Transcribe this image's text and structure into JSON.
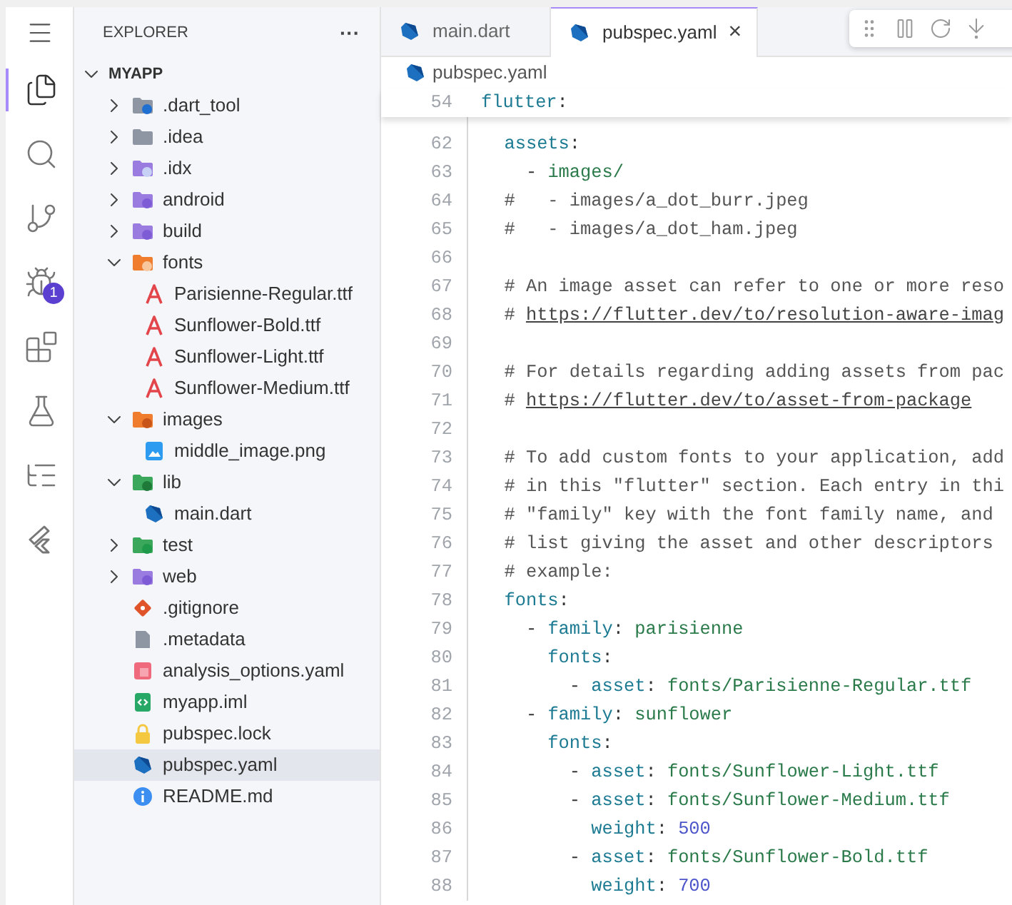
{
  "activity_bar": {
    "items": [
      {
        "kind": "files",
        "selected": true
      },
      {
        "kind": "search",
        "selected": false
      },
      {
        "kind": "git",
        "selected": false
      },
      {
        "kind": "debug",
        "selected": false,
        "badge": "1"
      },
      {
        "kind": "extensions",
        "selected": false
      },
      {
        "kind": "testing",
        "selected": false
      },
      {
        "kind": "outline",
        "selected": false
      },
      {
        "kind": "flutter",
        "selected": false
      }
    ]
  },
  "sidebar": {
    "title": "EXPLORER",
    "more": "···",
    "tree": {
      "label": "MYAPP",
      "expanded": true,
      "children": [
        {
          "label": ".dart_tool",
          "kind": "dartfolder",
          "expanded": false,
          "selected": false
        },
        {
          "label": ".idea",
          "kind": "folder",
          "expanded": false,
          "selected": false
        },
        {
          "label": ".idx",
          "kind": "idxfolder",
          "expanded": false,
          "selected": false
        },
        {
          "label": "android",
          "kind": "androidfolder",
          "expanded": false,
          "selected": false
        },
        {
          "label": "build",
          "kind": "buildfolder",
          "expanded": false,
          "selected": false
        },
        {
          "label": "fonts",
          "kind": "fontfolder",
          "expanded": true,
          "selected": false,
          "children": [
            {
              "label": "Parisienne-Regular.ttf",
              "kind": "font",
              "selected": false
            },
            {
              "label": "Sunflower-Bold.ttf",
              "kind": "font",
              "selected": false
            },
            {
              "label": "Sunflower-Light.ttf",
              "kind": "font",
              "selected": false
            },
            {
              "label": "Sunflower-Medium.ttf",
              "kind": "font",
              "selected": false
            }
          ]
        },
        {
          "label": "images",
          "kind": "imagefolder",
          "expanded": true,
          "selected": false,
          "children": [
            {
              "label": "middle_image.png",
              "kind": "image",
              "selected": false
            }
          ]
        },
        {
          "label": "lib",
          "kind": "libfolder",
          "expanded": true,
          "selected": false,
          "children": [
            {
              "label": "main.dart",
              "kind": "dart",
              "selected": false
            }
          ]
        },
        {
          "label": "test",
          "kind": "testfolder",
          "expanded": false,
          "selected": false
        },
        {
          "label": "web",
          "kind": "webfolder",
          "expanded": false,
          "selected": false
        },
        {
          "label": ".gitignore",
          "kind": "git",
          "selected": false
        },
        {
          "label": ".metadata",
          "kind": "file",
          "selected": false
        },
        {
          "label": "analysis_options.yaml",
          "kind": "yaml",
          "selected": false
        },
        {
          "label": "myapp.iml",
          "kind": "xml",
          "selected": false
        },
        {
          "label": "pubspec.lock",
          "kind": "lock",
          "selected": false
        },
        {
          "label": "pubspec.yaml",
          "kind": "dart",
          "selected": true
        },
        {
          "label": "README.md",
          "kind": "info",
          "selected": false
        }
      ]
    }
  },
  "tabs": [
    {
      "label": "main.dart",
      "selected": false
    },
    {
      "label": "pubspec.yaml",
      "selected": true,
      "close": "×"
    }
  ],
  "debug_toolbar": {
    "buttons": [
      {
        "kind": "grip"
      },
      {
        "kind": "pause"
      },
      {
        "kind": "stepover"
      },
      {
        "kind": "stepinto"
      }
    ]
  },
  "breadcrumb": "pubspec.yaml",
  "sticky_line": {
    "number": "54",
    "segments": [
      {
        "kind": "key",
        "text": "flutter"
      },
      {
        "kind": "punct",
        "text": ":"
      }
    ]
  },
  "lines": [
    {
      "number": "62",
      "segments": [
        {
          "kind": "key",
          "text": "  assets"
        },
        {
          "kind": "punct",
          "text": ":"
        }
      ]
    },
    {
      "number": "63",
      "segments": [
        {
          "kind": "punct",
          "text": "    - "
        },
        {
          "kind": "value",
          "text": "images/"
        }
      ]
    },
    {
      "number": "64",
      "segments": [
        {
          "kind": "comment",
          "text": "  #   - images/a_dot_burr.jpeg"
        }
      ]
    },
    {
      "number": "65",
      "segments": [
        {
          "kind": "comment",
          "text": "  #   - images/a_dot_ham.jpeg"
        }
      ]
    },
    {
      "number": "66"
    },
    {
      "number": "67",
      "segments": [
        {
          "kind": "comment",
          "text": "  # An image asset can refer to one or more reso"
        }
      ]
    },
    {
      "number": "68",
      "segments": [
        {
          "kind": "comment",
          "text": "  # "
        },
        {
          "kind": "link",
          "text": "https://flutter.dev/to/resolution-aware-imag"
        }
      ]
    },
    {
      "number": "69"
    },
    {
      "number": "70",
      "segments": [
        {
          "kind": "comment",
          "text": "  # For details regarding adding assets from pac"
        }
      ]
    },
    {
      "number": "71",
      "segments": [
        {
          "kind": "comment",
          "text": "  # "
        },
        {
          "kind": "link",
          "text": "https://flutter.dev/to/asset-from-package"
        }
      ]
    },
    {
      "number": "72"
    },
    {
      "number": "73",
      "segments": [
        {
          "kind": "comment",
          "text": "  # To add custom fonts to your application, add"
        }
      ]
    },
    {
      "number": "74",
      "segments": [
        {
          "kind": "comment",
          "text": "  # in this \"flutter\" section. Each entry in thi"
        }
      ]
    },
    {
      "number": "75",
      "segments": [
        {
          "kind": "comment",
          "text": "  # \"family\" key with the font family name, and"
        }
      ]
    },
    {
      "number": "76",
      "segments": [
        {
          "kind": "comment",
          "text": "  # list giving the asset and other descriptors"
        }
      ]
    },
    {
      "number": "77",
      "segments": [
        {
          "kind": "comment",
          "text": "  # example:"
        }
      ]
    },
    {
      "number": "78",
      "segments": [
        {
          "kind": "key",
          "text": "  fonts"
        },
        {
          "kind": "punct",
          "text": ":"
        }
      ]
    },
    {
      "number": "79",
      "segments": [
        {
          "kind": "punct",
          "text": "    - "
        },
        {
          "kind": "key",
          "text": "family"
        },
        {
          "kind": "punct",
          "text": ": "
        },
        {
          "kind": "value",
          "text": "parisienne"
        }
      ]
    },
    {
      "number": "80",
      "segments": [
        {
          "kind": "key",
          "text": "      fonts"
        },
        {
          "kind": "punct",
          "text": ":"
        }
      ]
    },
    {
      "number": "81",
      "segments": [
        {
          "kind": "punct",
          "text": "        - "
        },
        {
          "kind": "key",
          "text": "asset"
        },
        {
          "kind": "punct",
          "text": ": "
        },
        {
          "kind": "value",
          "text": "fonts/Parisienne-Regular.ttf"
        }
      ]
    },
    {
      "number": "82",
      "segments": [
        {
          "kind": "punct",
          "text": "    - "
        },
        {
          "kind": "key",
          "text": "family"
        },
        {
          "kind": "punct",
          "text": ": "
        },
        {
          "kind": "value",
          "text": "sunflower"
        }
      ]
    },
    {
      "number": "83",
      "segments": [
        {
          "kind": "key",
          "text": "      fonts"
        },
        {
          "kind": "punct",
          "text": ":"
        }
      ]
    },
    {
      "number": "84",
      "segments": [
        {
          "kind": "punct",
          "text": "        - "
        },
        {
          "kind": "key",
          "text": "asset"
        },
        {
          "kind": "punct",
          "text": ": "
        },
        {
          "kind": "value",
          "text": "fonts/Sunflower-Light.ttf"
        }
      ]
    },
    {
      "number": "85",
      "segments": [
        {
          "kind": "punct",
          "text": "        - "
        },
        {
          "kind": "key",
          "text": "asset"
        },
        {
          "kind": "punct",
          "text": ": "
        },
        {
          "kind": "value",
          "text": "fonts/Sunflower-Medium.ttf"
        }
      ]
    },
    {
      "number": "86",
      "segments": [
        {
          "kind": "key",
          "text": "          weight"
        },
        {
          "kind": "punct",
          "text": ": "
        },
        {
          "kind": "number",
          "text": "500"
        }
      ]
    },
    {
      "number": "87",
      "segments": [
        {
          "kind": "punct",
          "text": "        - "
        },
        {
          "kind": "key",
          "text": "asset"
        },
        {
          "kind": "punct",
          "text": ": "
        },
        {
          "kind": "value",
          "text": "fonts/Sunflower-Bold.ttf"
        }
      ]
    },
    {
      "number": "88",
      "segments": [
        {
          "kind": "key",
          "text": "          weight"
        },
        {
          "kind": "punct",
          "text": ": "
        },
        {
          "kind": "number",
          "text": "700"
        }
      ]
    }
  ]
}
